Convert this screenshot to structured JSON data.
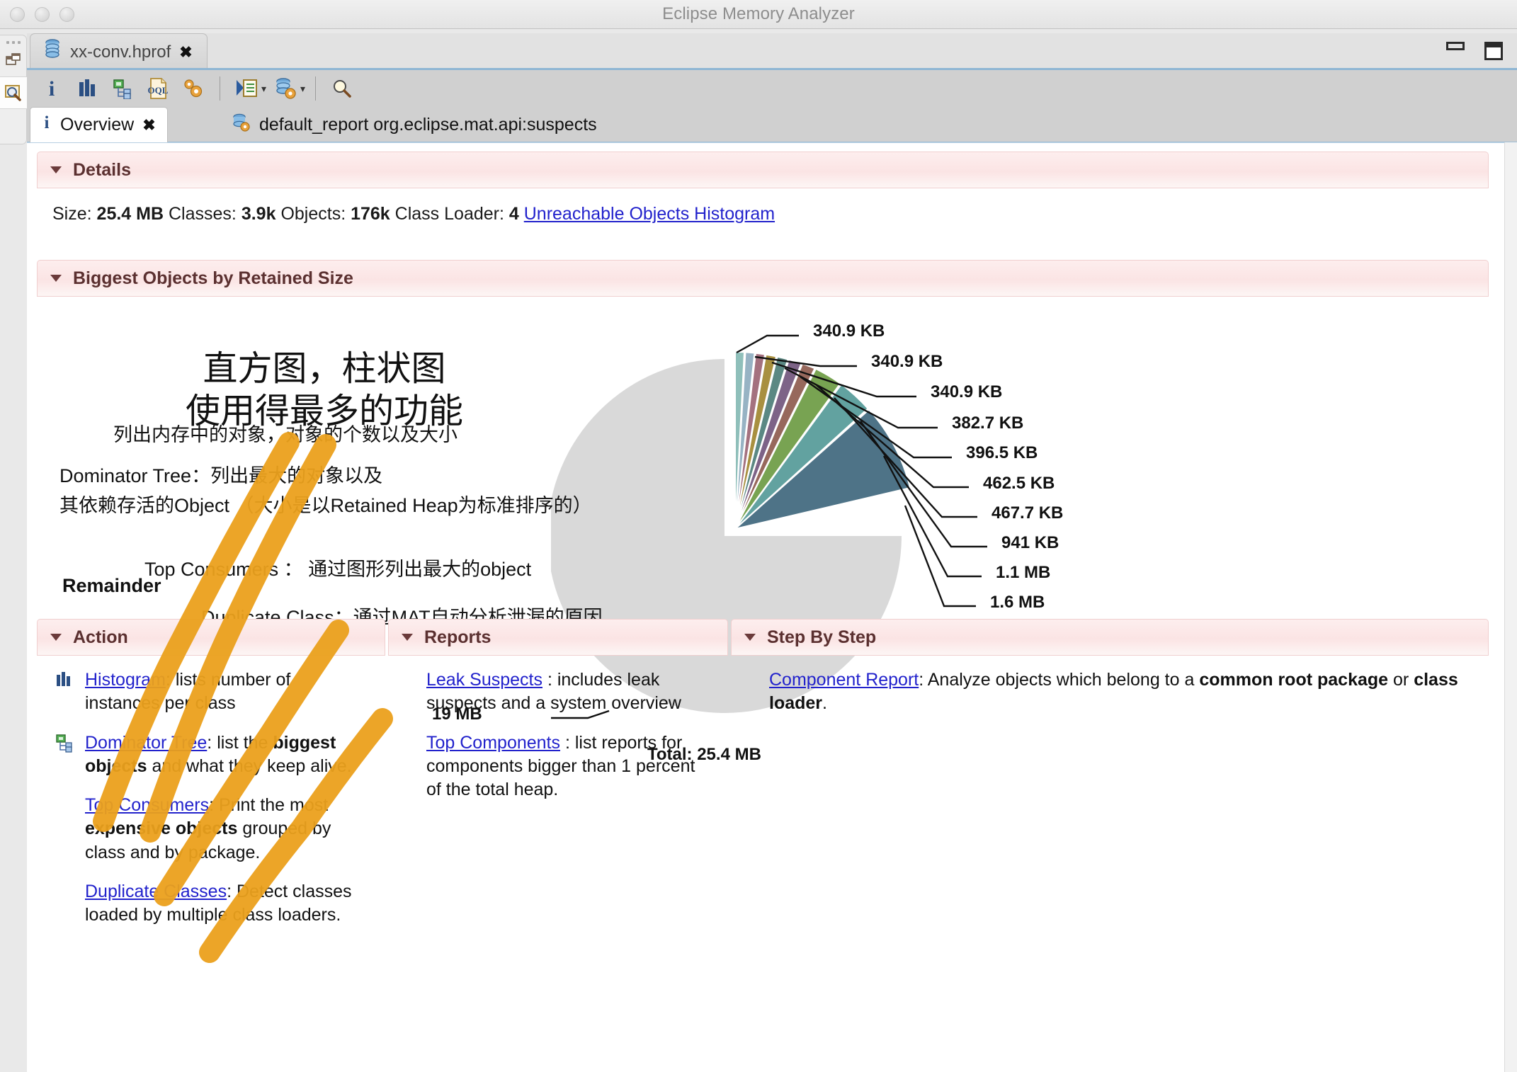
{
  "window": {
    "title": "Eclipse Memory Analyzer",
    "traffic_lights": [
      "close",
      "minimize",
      "zoom"
    ],
    "minimize_label": "minimize",
    "maximize_label": "maximize"
  },
  "editor_tab": {
    "label": "xx-conv.hprof",
    "icon": "heap-dump-icon",
    "close": "✖"
  },
  "toolbar": {
    "buttons": [
      {
        "name": "overview-info-button",
        "glyph": "i"
      },
      {
        "name": "histogram-button",
        "glyph": "histogram"
      },
      {
        "name": "dominator-tree-button",
        "glyph": "tree"
      },
      {
        "name": "oql-button",
        "glyph": "OQL"
      },
      {
        "name": "query-browser-button",
        "glyph": "gears"
      },
      {
        "name": "run-expert-system-test-button",
        "glyph": "run-report"
      },
      {
        "name": "open-heap-dump-button",
        "glyph": "heap-gear"
      },
      {
        "name": "find-button",
        "glyph": "magnifier"
      }
    ],
    "dropdown_arrow": "▾"
  },
  "view_tabs": [
    {
      "name": "tab-overview",
      "label": "Overview",
      "icon": "info-icon",
      "close": "✖",
      "active": true
    },
    {
      "name": "tab-default-report",
      "label": "default_report  org.eclipse.mat.api:suspects",
      "icon": "report-icon",
      "active": false
    }
  ],
  "details": {
    "header": "Details",
    "size_label": "Size:",
    "size_value": "25.4 MB",
    "classes_label": "Classes:",
    "classes_value": "3.9k",
    "objects_label": "Objects:",
    "objects_value": "176k",
    "classloader_label": "Class Loader:",
    "classloader_value": "4",
    "link": "Unreachable Objects Histogram"
  },
  "biggest_objects": {
    "header": "Biggest Objects by Retained Size",
    "total_label": "Total: 25.4 MB",
    "remainder_label": "Remainder"
  },
  "chart_data": {
    "type": "pie",
    "title": "Biggest Objects by Retained Size",
    "total": "25.4 MB",
    "annotation": "Total: 25.4 MB",
    "labels": [
      "340.9 KB",
      "340.9 KB",
      "340.9 KB",
      "382.7 KB",
      "396.5 KB",
      "462.5 KB",
      "467.7 KB",
      "941 KB",
      "1.1 MB",
      "1.6 MB",
      "19 MB"
    ],
    "values_mb": [
      0.3329,
      0.3329,
      0.3329,
      0.3737,
      0.3872,
      0.4517,
      0.4567,
      0.9189,
      1.1,
      1.6,
      19
    ],
    "colors": [
      "#8fbfba",
      "#97b3c4",
      "#a4717f",
      "#a89040",
      "#5b8883",
      "#7d6387",
      "#97685c",
      "#78a352",
      "#62a2a0",
      "#4e7387",
      "#d9d9d9"
    ],
    "legend_position": "callout-right",
    "grid": false
  },
  "annotations": {
    "title_line1": "直方图，柱状图",
    "title_line2": "使用得最多的功能",
    "subtitle": "列出内存中的对象，对象的个数以及大小",
    "dominator_tree": "Dominator Tree：列出最大的对象以及",
    "dominator_tree2": "其依赖存活的Object （大小是以Retained Heap为标准排序的）",
    "top_consumers": "Top Consumers ： 通过图形列出最大的object",
    "duplicate_class": "Duplicate Class：通过MAT自动分析泄漏的原因",
    "highlight_color": "#eba11d"
  },
  "panels": {
    "action": {
      "header": "Action",
      "items": [
        {
          "icon": "histogram-icon",
          "link": "Histogram",
          "text": ": lists number of instances per class"
        },
        {
          "icon": "dominator-tree-icon",
          "link": "Dominator Tree",
          "text": ": list the ",
          "bold": "biggest objects",
          "text2": " and what they keep alive."
        },
        {
          "icon": "",
          "link": "Top Consumers",
          "text": ": Print the most  ",
          "bold": "expensive objects",
          "text2": " grouped by class and by package."
        },
        {
          "icon": "",
          "link": "Duplicate Classes",
          "text": ": Detect classes loaded by multiple class loaders."
        }
      ]
    },
    "reports": {
      "header": "Reports",
      "items": [
        {
          "link": "Leak Suspects",
          "text": " : includes leak suspects and a system overview"
        },
        {
          "link": "Top Components",
          "text": " : list reports for components bigger than 1 percent of the total heap."
        }
      ]
    },
    "step_by_step": {
      "header": "Step By Step",
      "items": [
        {
          "link": "Component Report",
          "text": ": Analyze objects which belong to a ",
          "bold": "common root package",
          "text2": " or ",
          "bold2": "class loader",
          "text3": "."
        }
      ]
    }
  }
}
